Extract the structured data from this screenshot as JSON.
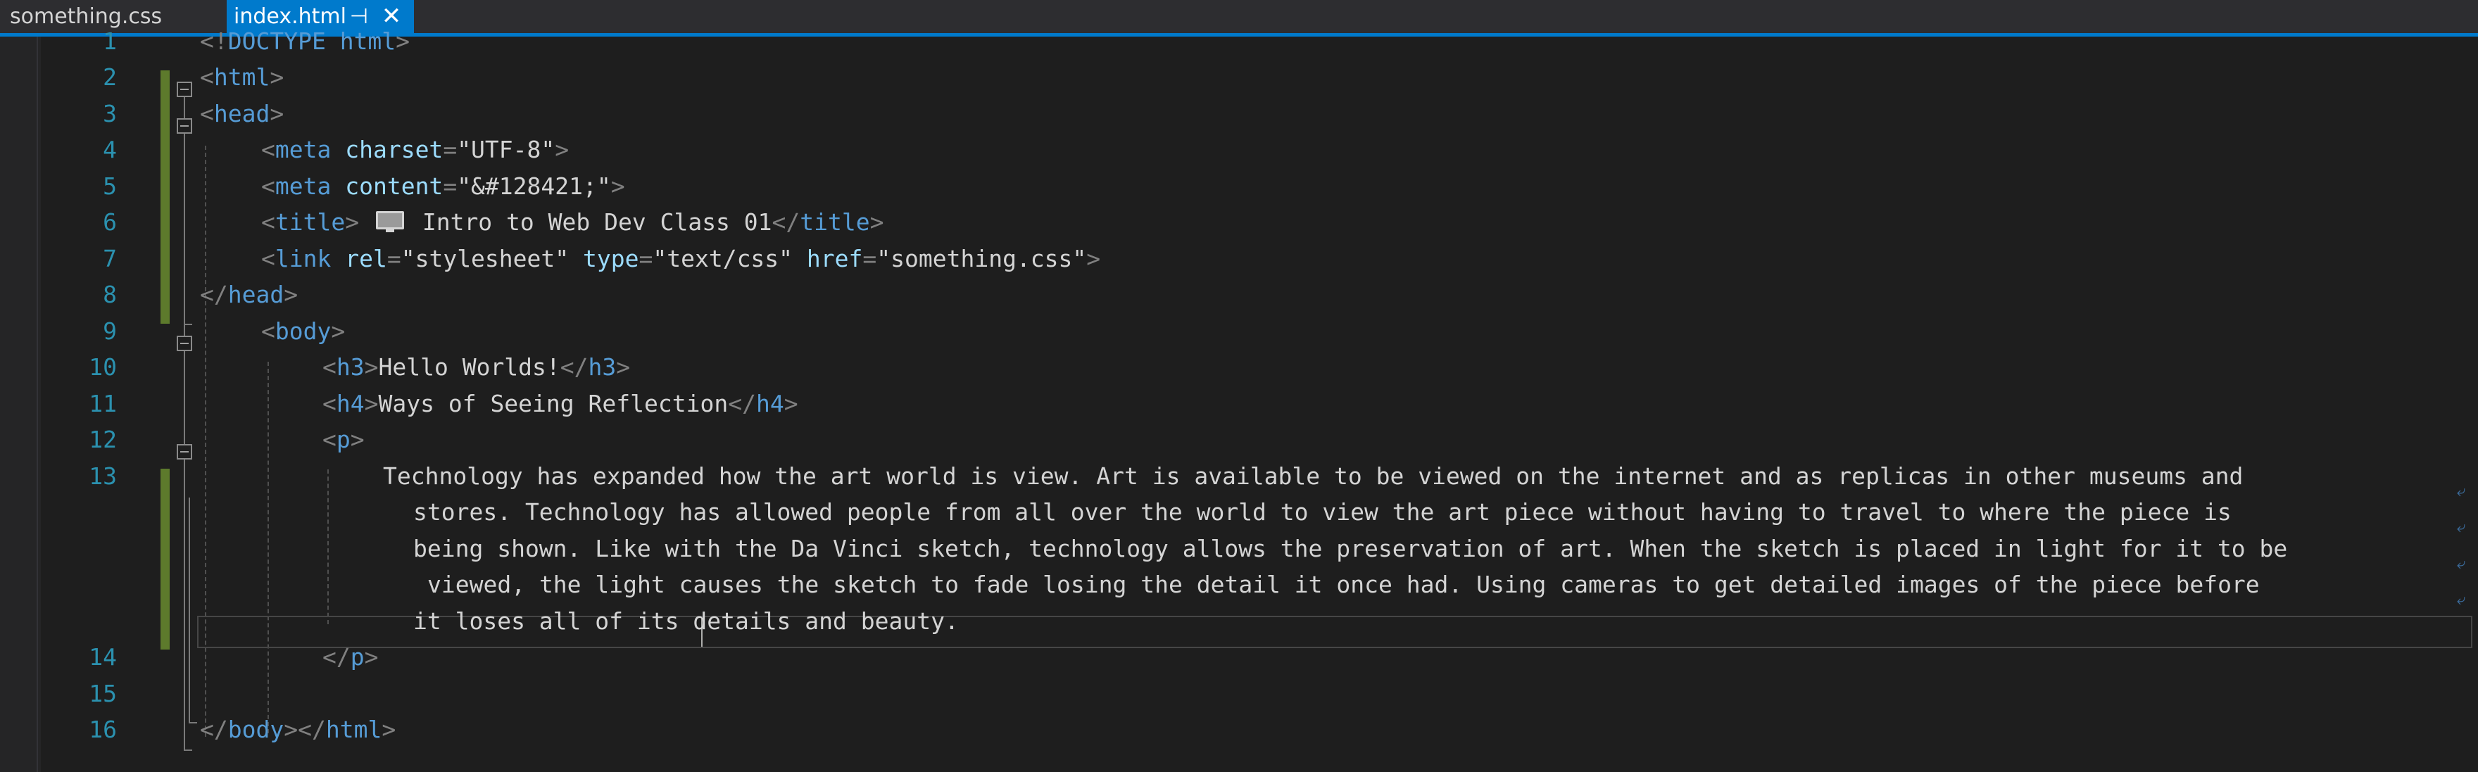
{
  "tabs": {
    "inactive_label": "something.css",
    "active_label": "index.html",
    "pin_glyph": "⊣",
    "close_glyph": "✕"
  },
  "line_numbers": [
    "1",
    "2",
    "3",
    "4",
    "5",
    "6",
    "7",
    "8",
    "9",
    "10",
    "11",
    "12",
    "13",
    "14",
    "15",
    "16"
  ],
  "code": {
    "l1": {
      "open": "<!",
      "tag": "DOCTYPE",
      "attr": " html",
      "close": ">"
    },
    "l2": {
      "open": "<",
      "tag": "html",
      "close": ">"
    },
    "l3": {
      "open": "<",
      "tag": "head",
      "close": ">"
    },
    "l4": {
      "open": "<",
      "tag": "meta",
      "attr": " charset",
      "eq": "=",
      "val": "\"UTF-8\"",
      "close": ">"
    },
    "l5": {
      "open": "<",
      "tag": "meta",
      "attr": " content",
      "eq": "=",
      "val": "\"&#128421;\"",
      "close": ">"
    },
    "l6": {
      "open": "<",
      "tag": "title",
      "close": ">",
      "text": " Intro to Web Dev Class 01",
      "end_open": "</",
      "end_tag": "title",
      "end_close": ">"
    },
    "l7": {
      "open": "<",
      "tag": "link",
      "a1": " rel",
      "v1": "\"stylesheet\"",
      "a2": " type",
      "v2": "\"text/css\"",
      "a3": " href",
      "v3": "\"something.css\"",
      "eq": "=",
      "close": ">"
    },
    "l8": {
      "open": "</",
      "tag": "head",
      "close": ">"
    },
    "l9": {
      "open": "<",
      "tag": "body",
      "close": ">"
    },
    "l10": {
      "open": "<",
      "tag": "h3",
      "close": ">",
      "text": "Hello Worlds!",
      "end_open": "</",
      "end_tag": "h3",
      "end_close": ">"
    },
    "l11": {
      "open": "<",
      "tag": "h4",
      "close": ">",
      "text": "Ways of Seeing Reflection",
      "end_open": "</",
      "end_tag": "h4",
      "end_close": ">"
    },
    "l12": {
      "open": "<",
      "tag": "p",
      "close": ">"
    },
    "l13": [
      "Technology has expanded how the art world is view. Art is available to be viewed on the internet and as replicas in other museums and",
      "stores. Technology has allowed people from all over the world to view the art piece without having to travel to where the piece is",
      "being shown. Like with the Da Vinci sketch, technology allows the preservation of art. When the sketch is placed in light for it to be",
      "viewed, the light causes the sketch to fade losing the detail it once had. Using cameras to get detailed images of the piece before",
      "it loses all of its details and beauty."
    ],
    "l14": {
      "open": "</",
      "tag": "p",
      "close": ">"
    },
    "l16": {
      "open": "</",
      "tag": "body",
      "close": ">",
      "open2": "</",
      "tag2": "html",
      "close2": ">"
    }
  },
  "wrap_glyph": "⤶",
  "icons": [
    "pin-icon",
    "close-icon",
    "monitor-icon",
    "fold-toggle-icon",
    "word-wrap-icon"
  ],
  "colors": {
    "accent": "#007acc",
    "background": "#1e1e1e",
    "tag": "#569cd6",
    "attribute": "#9cdcfe",
    "punctuation": "#808080",
    "line_number": "#2b91af",
    "change_bar": "#5d7a2c"
  }
}
